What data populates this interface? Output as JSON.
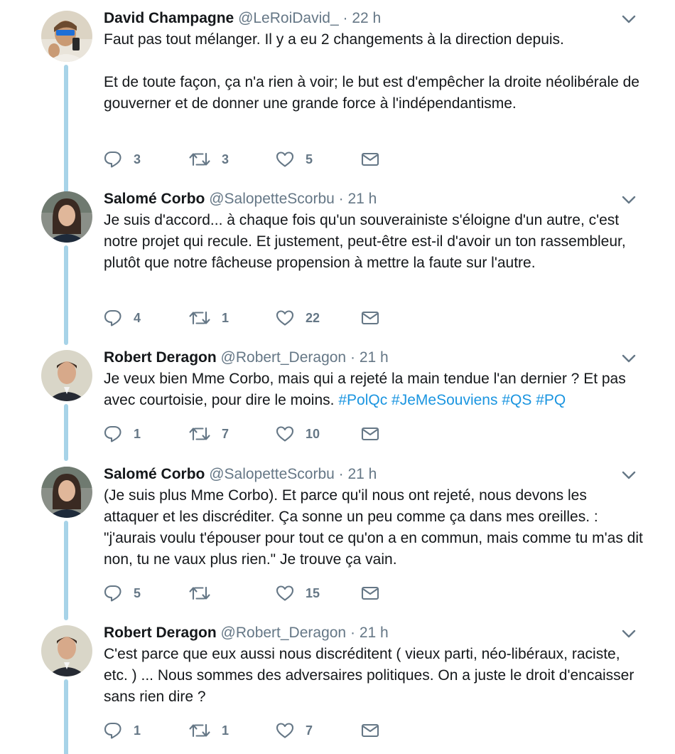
{
  "tweets": [
    {
      "name": "David Champagne",
      "handle": "@LeRoiDavid_",
      "time": "22 h",
      "paragraphs": [
        [
          {
            "text": "Faut pas tout mélanger. Il y a eu 2 changements à la direction depuis."
          }
        ],
        [
          {
            "text": "Et de toute façon, ça n'a rien à voir; le but est d'empêcher la droite néolibérale de gouverner et de donner une grande force à l'indépendantisme."
          }
        ]
      ],
      "replies": "3",
      "retweets": "3",
      "likes": "5"
    },
    {
      "name": "Salomé Corbo",
      "handle": "@SalopetteScorbu",
      "time": "21 h",
      "paragraphs": [
        [
          {
            "text": "Je suis d'accord... à chaque fois qu'un souverainiste s'éloigne d'un autre, c'est notre projet qui recule. Et justement, peut-être est-il d'avoir un ton rassembleur, plutôt que notre fâcheuse propension à mettre la faute sur l'autre."
          }
        ]
      ],
      "replies": "4",
      "retweets": "1",
      "likes": "22"
    },
    {
      "name": "Robert Deragon",
      "handle": "@Robert_Deragon",
      "time": "21 h",
      "paragraphs": [
        [
          {
            "text": "Je veux bien Mme Corbo, mais qui a rejeté la main tendue l'an dernier ? Et pas avec courtoisie, pour dire le moins. "
          },
          {
            "text": "#PolQc",
            "hashtag": true
          },
          {
            "text": " "
          },
          {
            "text": "#JeMeSouviens",
            "hashtag": true
          },
          {
            "text": " "
          },
          {
            "text": "#QS",
            "hashtag": true
          },
          {
            "text": " "
          },
          {
            "text": "#PQ",
            "hashtag": true
          }
        ]
      ],
      "replies": "1",
      "retweets": "7",
      "likes": "10"
    },
    {
      "name": "Salomé Corbo",
      "handle": "@SalopetteScorbu",
      "time": "21 h",
      "paragraphs": [
        [
          {
            "text": "(Je suis plus Mme Corbo). Et parce qu'il nous ont rejeté, nous devons les attaquer et les discréditer. Ça sonne un peu comme ça dans mes oreilles. : \"j'aurais voulu t'épouser pour tout ce qu'on a en commun, mais comme tu m'as dit non, tu ne vaux plus rien.\" Je trouve ça vain."
          }
        ]
      ],
      "replies": "5",
      "retweets": "",
      "likes": "15"
    },
    {
      "name": "Robert Deragon",
      "handle": "@Robert_Deragon",
      "time": "21 h",
      "paragraphs": [
        [
          {
            "text": "C'est parce que eux aussi nous discréditent ( vieux parti, néo-libéraux, raciste, etc. ) ... Nous sommes des adversaires politiques. On a juste le droit d'encaisser sans rien dire ?"
          }
        ]
      ],
      "replies": "1",
      "retweets": "1",
      "likes": "7"
    }
  ],
  "separator": "·",
  "colors": {
    "text": "#14171a",
    "muted": "#657786",
    "hashtag": "#1b95e0",
    "thread_line": "#a7d3e8"
  },
  "icons": [
    "chevron-down-icon",
    "reply-icon",
    "retweet-icon",
    "like-icon",
    "direct-message-icon"
  ]
}
